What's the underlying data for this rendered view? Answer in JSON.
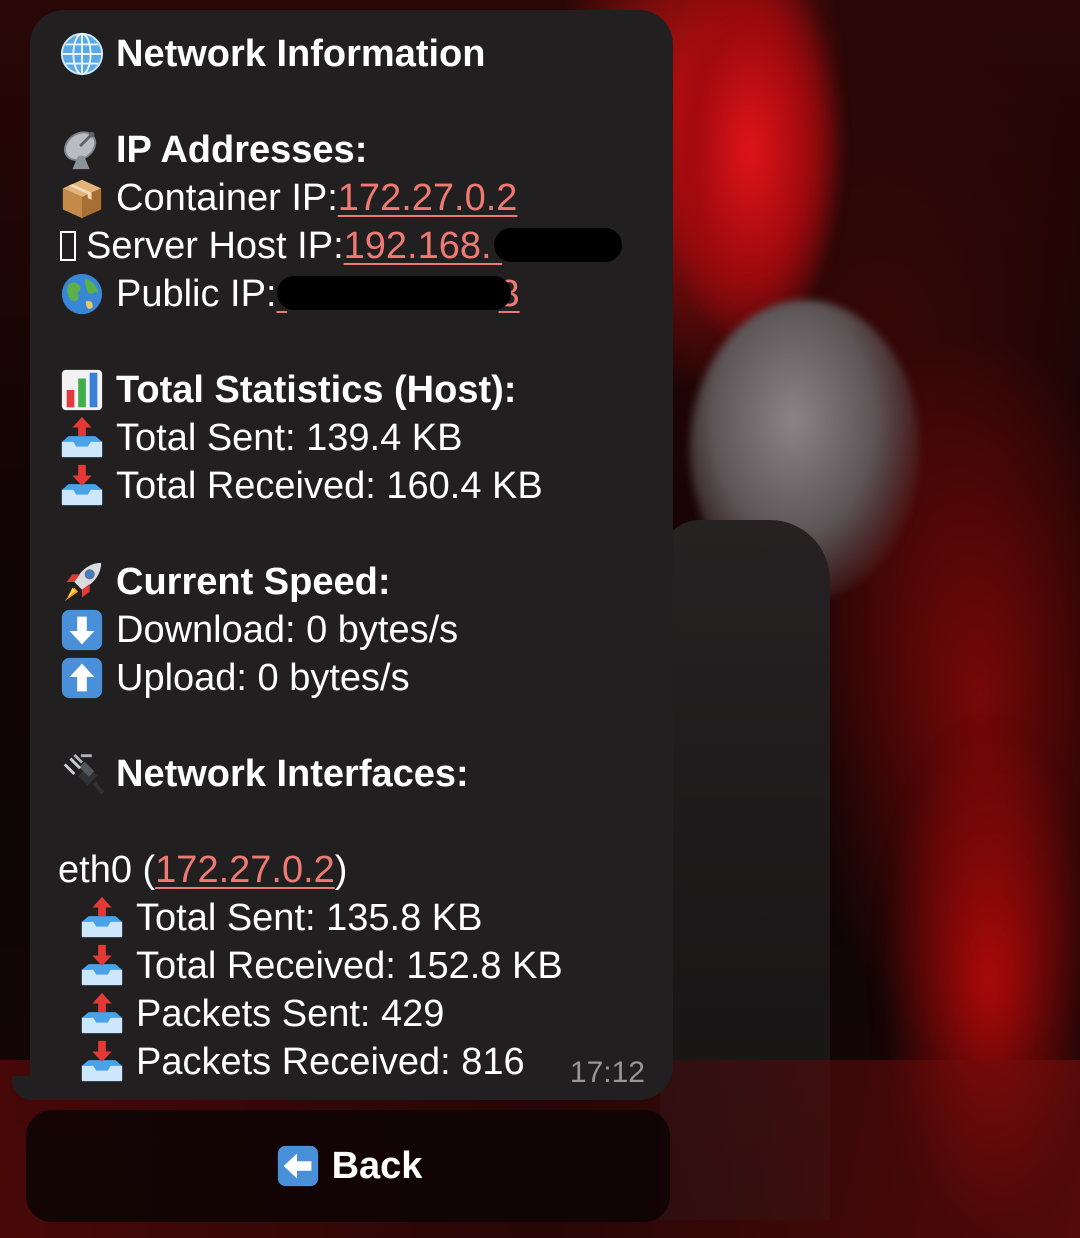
{
  "message": {
    "title": "Network Information",
    "ip_section": {
      "header": "IP Addresses:",
      "container_label": "Container IP: ",
      "container_ip": "172.27.0.2",
      "server_label": "Server Host IP: ",
      "server_ip_visible": "192.168.",
      "public_label": "Public IP: ",
      "public_ip_visible": "3"
    },
    "stats_section": {
      "header": "Total Statistics (Host):",
      "total_sent": "Total Sent: 139.4 KB",
      "total_received": "Total Received: 160.4 KB"
    },
    "speed_section": {
      "header": "Current Speed:",
      "download": "Download: 0 bytes/s",
      "upload": "Upload: 0 bytes/s"
    },
    "interfaces_section": {
      "header": "Network Interfaces:",
      "iface_name": "eth0 (",
      "iface_ip": "172.27.0.2",
      "iface_close": ")",
      "total_sent": "Total Sent: 135.8 KB",
      "total_received": "Total Received: 152.8 KB",
      "packets_sent": "Packets Sent: 429",
      "packets_received": "Packets Received: 816"
    },
    "time": "17:12"
  },
  "keyboard": {
    "back_label": "Back"
  },
  "colors": {
    "bubble": "#221f20",
    "link": "#ef7a74",
    "text": "#ffffff",
    "timestamp": "#9a9697"
  },
  "icons": {
    "title": "globe-with-meridians-icon",
    "ip": "satellite-antenna-icon",
    "container": "package-icon",
    "server": "missing-glyph-icon",
    "public": "earth-globe-icon",
    "stats": "bar-chart-icon",
    "sent": "outbox-tray-icon",
    "received": "inbox-tray-icon",
    "speed": "rocket-icon",
    "download": "down-arrow-icon",
    "upload": "up-arrow-icon",
    "interfaces": "electric-plug-icon",
    "back": "left-arrow-icon"
  }
}
